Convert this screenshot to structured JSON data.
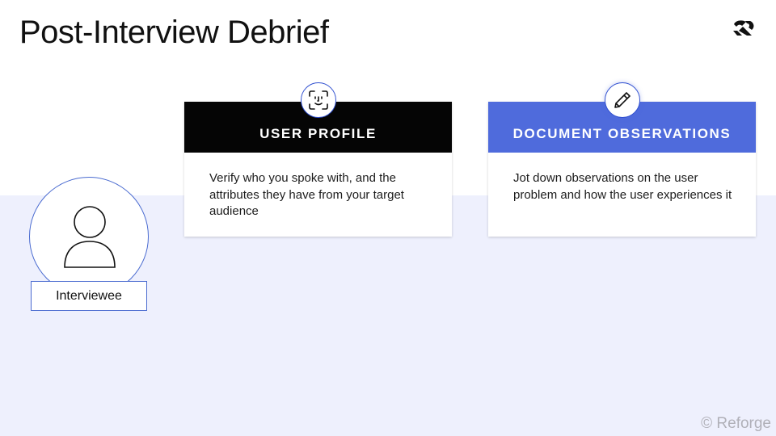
{
  "page": {
    "title": "Post-Interview Debrief"
  },
  "logo": {
    "icon": "reforge-logo-icon"
  },
  "cards": [
    {
      "title": "USER PROFILE",
      "body": "Verify who you spoke with, and the attributes they have from your target audience",
      "icon": "face-scan-icon",
      "header_color": "#050505"
    },
    {
      "title": "DOCUMENT OBSERVATIONS",
      "body": "Jot down observations on the user problem and how the user experiences it",
      "icon": "pencil-icon",
      "header_color": "#4f6bdc"
    }
  ],
  "avatar": {
    "label": "Interviewee",
    "icon": "person-icon"
  },
  "footer": {
    "copyright": "© Reforge"
  },
  "colors": {
    "accent": "#4f6bdc",
    "band": "#eef0fd",
    "outline": "#4a6bd0"
  }
}
